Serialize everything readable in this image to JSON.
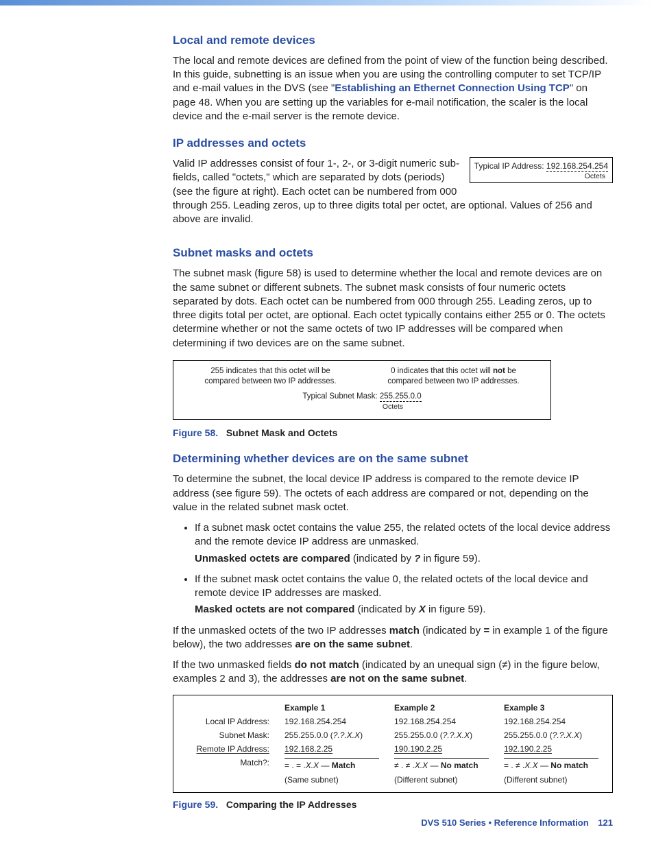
{
  "sections": {
    "s1": {
      "title": "Local and remote devices",
      "p1a": "The local and remote devices are defined from the point of view of the function being described. In this guide, subnetting is an issue when you are using the controlling computer to set TCP/IP and e-mail values in the DVS (see \"",
      "link": "Establishing an Ethernet Connection Using TCP",
      "p1b": "\" on page 48. When you are setting up the variables for e-mail notification, the scaler is the local device and the e-mail server is the remote device."
    },
    "s2": {
      "title": "IP addresses and octets",
      "p1": "Valid IP addresses consist of four 1-, 2-, or 3-digit numeric sub-fields, called \"octets,\" which are separated by dots (periods) (see the figure at right). Each octet can be numbered from 000 through 255. Leading zeros, up to three digits total per octet, are optional. Values of 256 and above are invalid.",
      "ipbox": {
        "label": "Typical IP Address:",
        "value": "192.168.254.254",
        "sub": "Octets"
      }
    },
    "s3": {
      "title": "Subnet masks and octets",
      "p1": "The subnet mask (figure 58) is used to determine whether the local and remote devices are on the same subnet or different subnets. The subnet mask consists of four numeric octets separated by dots. Each octet can be numbered from 000 through 255. Leading zeros, up to three digits total per octet, are optional. Each octet typically contains either 255 or 0. The octets determine whether or not the same octets of two IP addresses will be compared when determining if two devices are on the same subnet.",
      "maskbox": {
        "left_a": "255 indicates that this octet will be",
        "left_b": "compared between two IP addresses.",
        "right_a": "0 indicates that this octet will ",
        "right_not": "not",
        "right_b": " be",
        "right_c": "compared between two IP addresses.",
        "label": "Typical Subnet Mask:",
        "value": "255.255.0.0",
        "sub": "Octets"
      },
      "figcap": {
        "num": "Figure 58.",
        "title": "Subnet Mask and Octets"
      }
    },
    "s4": {
      "title": "Determining whether devices are on the same subnet",
      "p1": "To determine the subnet, the local device IP address is compared to the remote device IP address (see figure 59). The octets of each address are compared or not, depending on the value in the related subnet mask octet.",
      "b1": "If a subnet mask octet contains the value 255, the related octets of the local device address and the remote device IP address are unmasked.",
      "b1s_a": "Unmasked octets are compared",
      "b1s_b": " (indicated by ",
      "b1s_q": "?",
      "b1s_c": " in figure 59).",
      "b2": "If the subnet mask octet contains the value 0, the related octets of the local device and remote device IP addresses are masked.",
      "b2s_a": "Masked octets are not compared",
      "b2s_b": " (indicated by ",
      "b2s_x": "X",
      "b2s_c": " in figure 59).",
      "p2a": "If the unmasked octets of the two IP addresses ",
      "p2b": "match",
      "p2c": " (indicated by ",
      "p2d": "=",
      "p2e": " in example 1 of the figure below), the two addresses ",
      "p2f": "are on the same subnet",
      "p2g": ".",
      "p3a": "If the two unmasked fields ",
      "p3b": "do not match",
      "p3c": " (indicated by an unequal sign (≠) in the figure below, examples 2 and 3), the addresses ",
      "p3d": "are not on the same subnet",
      "p3e": "."
    },
    "fig59": {
      "rowlabels": {
        "local": "Local IP Address:",
        "mask": "Subnet Mask:",
        "remote": "Remote IP Address:",
        "match": "Match?:"
      },
      "ex1": {
        "hdr": "Example 1",
        "local": "192.168.254.254",
        "mask_a": "255.255.0.0 (",
        "mask_b": "?.?.X.X",
        "mask_c": ")",
        "remote": "192.168.2.25",
        "match_a": " =  .  =  .",
        "match_b": "X.X",
        "match_c": " — ",
        "match_d": "Match",
        "outcome": "(Same subnet)"
      },
      "ex2": {
        "hdr": "Example 2",
        "local": "192.168.254.254",
        "mask_a": "255.255.0.0 (",
        "mask_b": "?.?.X.X",
        "mask_c": ")",
        "remote": "190.190.2.25",
        "match_a": " ≠  .  ≠  .",
        "match_b": "X.X",
        "match_c": " — ",
        "match_d": "No match",
        "outcome": "(Different subnet)"
      },
      "ex3": {
        "hdr": "Example 3",
        "local": "192.168.254.254",
        "mask_a": "255.255.0.0 (",
        "mask_b": "?.?.X.X",
        "mask_c": ")",
        "remote": "192.190.2.25",
        "match_a": " =  .  ≠  .",
        "match_b": "X.X",
        "match_c": " — ",
        "match_d": "No match",
        "outcome": "(Different subnet)"
      },
      "figcap": {
        "num": "Figure 59.",
        "title": "Comparing the IP Addresses"
      }
    }
  },
  "footer": {
    "series": "DVS 510 Series • Reference Information",
    "page": "121"
  }
}
